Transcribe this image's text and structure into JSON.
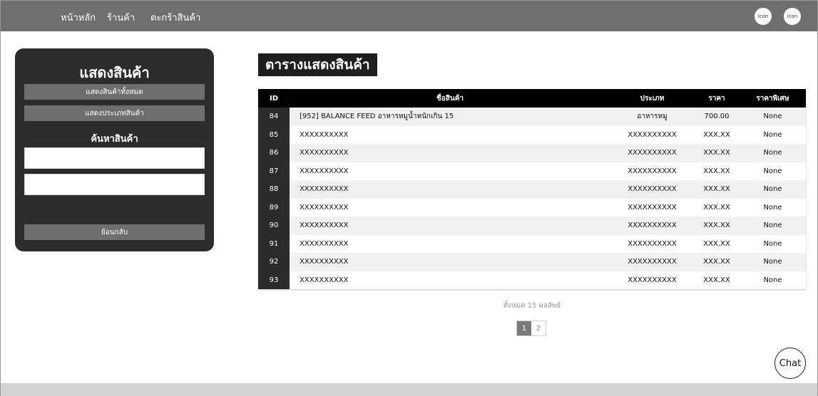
{
  "nav": {
    "links": [
      "หน้าหลัก",
      "ร้านค้า",
      "ตะกร้าสินค้า"
    ],
    "icon_label_1": "icon",
    "icon_label_2": "icon"
  },
  "sidebar": {
    "title": "แสดงสินค้า",
    "show_all_label": "แสดงสินค้าทั้งหมด",
    "show_types_label": "แสดงประเภทสินค้า",
    "search_heading": "ค้นหาสินค้า",
    "input_1_value": "",
    "input_2_value": "",
    "back_label": "ย้อนกลับ"
  },
  "main": {
    "title": "ตารางแสดงสินค้า",
    "columns": [
      "ID",
      "ชื่อสินค้า",
      "ประเภท",
      "ราคา",
      "ราคาพิเศษ"
    ],
    "rows": [
      {
        "id": "84",
        "name": "[952] BALANCE FEED อาหารหมูน้ำหนักเกิน 15",
        "type": "อาหารหมู",
        "price": "700.00",
        "special": "None"
      },
      {
        "id": "85",
        "name": "XXXXXXXXXX",
        "type": "XXXXXXXXXX",
        "price": "XXX.XX",
        "special": "None"
      },
      {
        "id": "86",
        "name": "XXXXXXXXXX",
        "type": "XXXXXXXXXX",
        "price": "XXX.XX",
        "special": "None"
      },
      {
        "id": "87",
        "name": "XXXXXXXXXX",
        "type": "XXXXXXXXXX",
        "price": "XXX.XX",
        "special": "None"
      },
      {
        "id": "88",
        "name": "XXXXXXXXXX",
        "type": "XXXXXXXXXX",
        "price": "XXX.XX",
        "special": "None"
      },
      {
        "id": "89",
        "name": "XXXXXXXXXX",
        "type": "XXXXXXXXXX",
        "price": "XXX.XX",
        "special": "None"
      },
      {
        "id": "90",
        "name": "XXXXXXXXXX",
        "type": "XXXXXXXXXX",
        "price": "XXX.XX",
        "special": "None"
      },
      {
        "id": "91",
        "name": "XXXXXXXXXX",
        "type": "XXXXXXXXXX",
        "price": "XXX.XX",
        "special": "None"
      },
      {
        "id": "92",
        "name": "XXXXXXXXXX",
        "type": "XXXXXXXXXX",
        "price": "XXX.XX",
        "special": "None"
      },
      {
        "id": "93",
        "name": "XXXXXXXXXX",
        "type": "XXXXXXXXXX",
        "price": "XXX.XX",
        "special": "None"
      }
    ],
    "total_text": "ทั้งหมด 15 ผลลัพธ์",
    "pages": [
      "1",
      "2"
    ],
    "chat_label": "Chat"
  }
}
